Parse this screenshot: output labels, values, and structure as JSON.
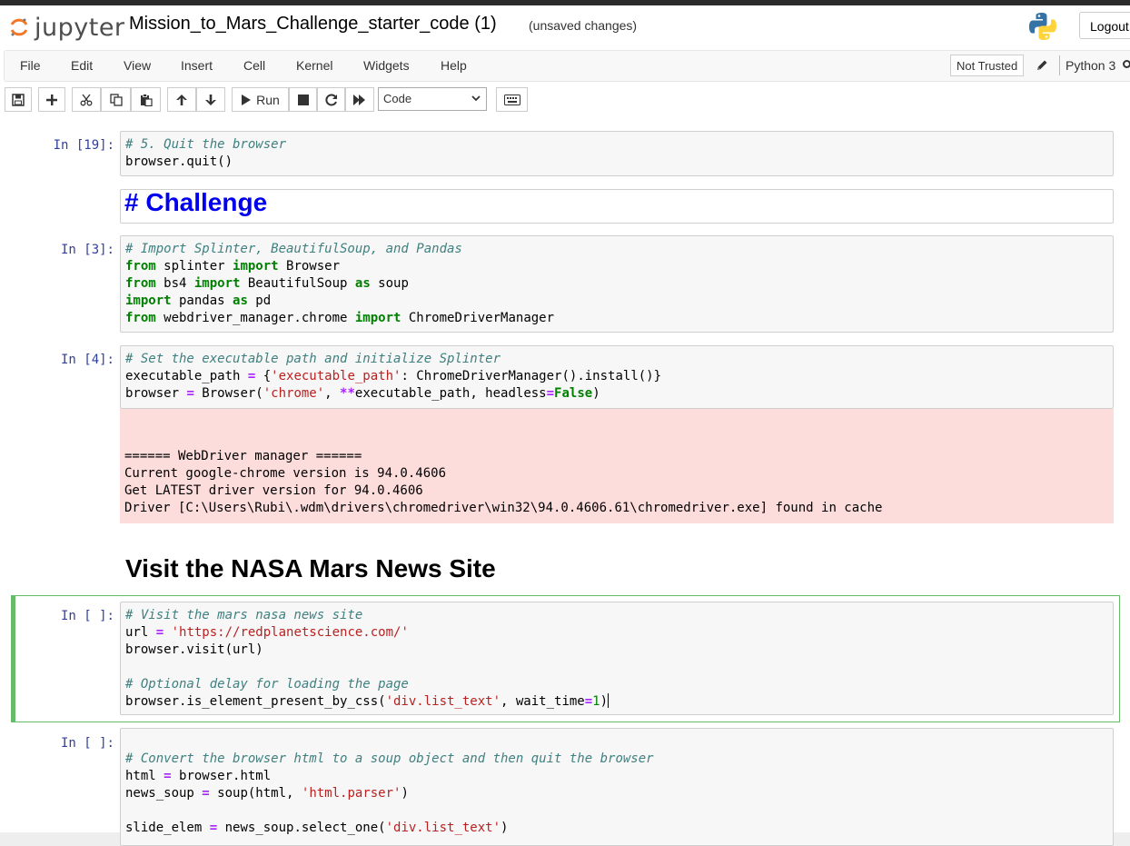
{
  "header": {
    "app_name": "jupyter",
    "notebook_title": "Mission_to_Mars_Challenge_starter_code (1)",
    "save_status": "(unsaved changes)",
    "logout_label": "Logout"
  },
  "menu": {
    "items": [
      "File",
      "Edit",
      "View",
      "Insert",
      "Cell",
      "Kernel",
      "Widgets",
      "Help"
    ],
    "not_trusted": "Not Trusted",
    "kernel_name": "Python 3"
  },
  "toolbar": {
    "run_label": "Run",
    "cell_type": "Code"
  },
  "cells": {
    "c1": {
      "prompt": "In [19]:",
      "lines": [
        "# 5. Quit the browser",
        "browser.quit()"
      ]
    },
    "md1": {
      "text": "# Challenge"
    },
    "c2": {
      "prompt": "In [3]:"
    },
    "c3": {
      "prompt": "In [4]:"
    },
    "c3_out": {
      "l1": "====== WebDriver manager ======",
      "l2": "Current google-chrome version is 94.0.4606",
      "l3": "Get LATEST driver version for 94.0.4606",
      "l4": "Driver [C:\\Users\\Rubi\\.wdm\\drivers\\chromedriver\\win32\\94.0.4606.61\\chromedriver.exe] found in cache"
    },
    "md2": {
      "text": "Visit the NASA Mars News Site"
    },
    "c4": {
      "prompt": "In [ ]:"
    },
    "c5": {
      "prompt": "In [ ]:"
    }
  },
  "colors": {
    "prompt": "#303f9f",
    "comment": "#408080",
    "keyword": "#008000",
    "string": "#ba2121",
    "operator": "#aa22ff",
    "error_bg": "#fddcdc",
    "selected_border": "#66bb6a",
    "heading_blue": "#0000ee"
  },
  "icons": [
    "jupyter-logo",
    "python-logo",
    "pencil-icon",
    "save-icon",
    "plus-icon",
    "scissors-icon",
    "copy-icon",
    "paste-icon",
    "arrow-up-icon",
    "arrow-down-icon",
    "play-icon",
    "stop-icon",
    "restart-icon",
    "fast-forward-icon",
    "keyboard-icon"
  ]
}
